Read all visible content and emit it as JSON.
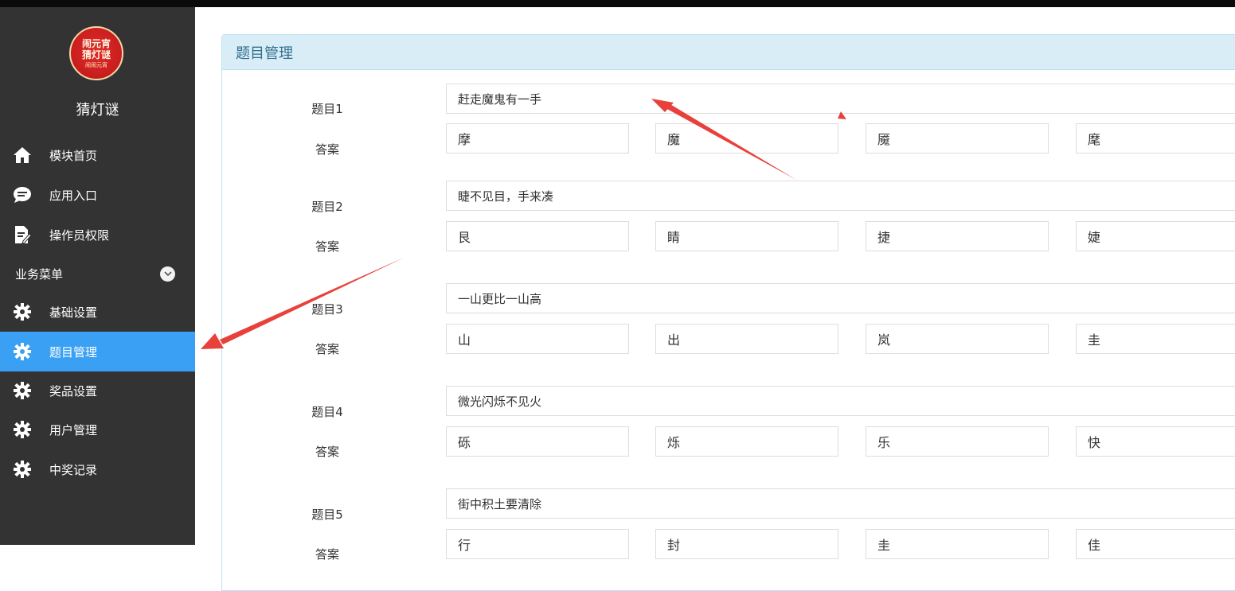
{
  "sidebar": {
    "logo_line1": "闹元宵",
    "logo_line2": "猜灯谜",
    "logo_line3": "闹闹元宵",
    "app_name": "猜灯谜",
    "top_items": [
      {
        "label": "模块首页",
        "icon": "home-icon"
      },
      {
        "label": "应用入口",
        "icon": "chat-bubble-icon"
      },
      {
        "label": "操作员权限",
        "icon": "document-edit-icon"
      }
    ],
    "section_label": "业务菜单",
    "section_icon": "chevron-down-icon",
    "menu_items": [
      {
        "label": "基础设置",
        "icon": "gear-icon",
        "active": false
      },
      {
        "label": "题目管理",
        "icon": "gear-icon",
        "active": true
      },
      {
        "label": "奖品设置",
        "icon": "gear-icon",
        "active": false
      },
      {
        "label": "用户管理",
        "icon": "gear-icon",
        "active": false
      },
      {
        "label": "中奖记录",
        "icon": "gear-icon",
        "active": false
      }
    ],
    "active_color": "#3aa0f3",
    "bg_color": "#333333"
  },
  "panel": {
    "title": "题目管理",
    "questions": [
      {
        "label": "题目1",
        "value": "赶走魔鬼有一手",
        "answer_label": "答案",
        "answers": [
          "摩",
          "魔",
          "魇",
          "麾"
        ]
      },
      {
        "label": "题目2",
        "value": "睫不见目，手来凑",
        "answer_label": "答案",
        "answers": [
          "艮",
          "睛",
          "捷",
          "婕"
        ]
      },
      {
        "label": "题目3",
        "value": "一山更比一山高",
        "answer_label": "答案",
        "answers": [
          "山",
          "出",
          "岚",
          "圭"
        ]
      },
      {
        "label": "题目4",
        "value": "微光闪烁不见火",
        "answer_label": "答案",
        "answers": [
          "砾",
          "烁",
          "乐",
          "快"
        ]
      },
      {
        "label": "题目5",
        "value": "街中积土要清除",
        "answer_label": "答案",
        "answers": [
          "行",
          "封",
          "圭",
          "佳"
        ]
      }
    ]
  },
  "annotation_color": "#e8413c"
}
